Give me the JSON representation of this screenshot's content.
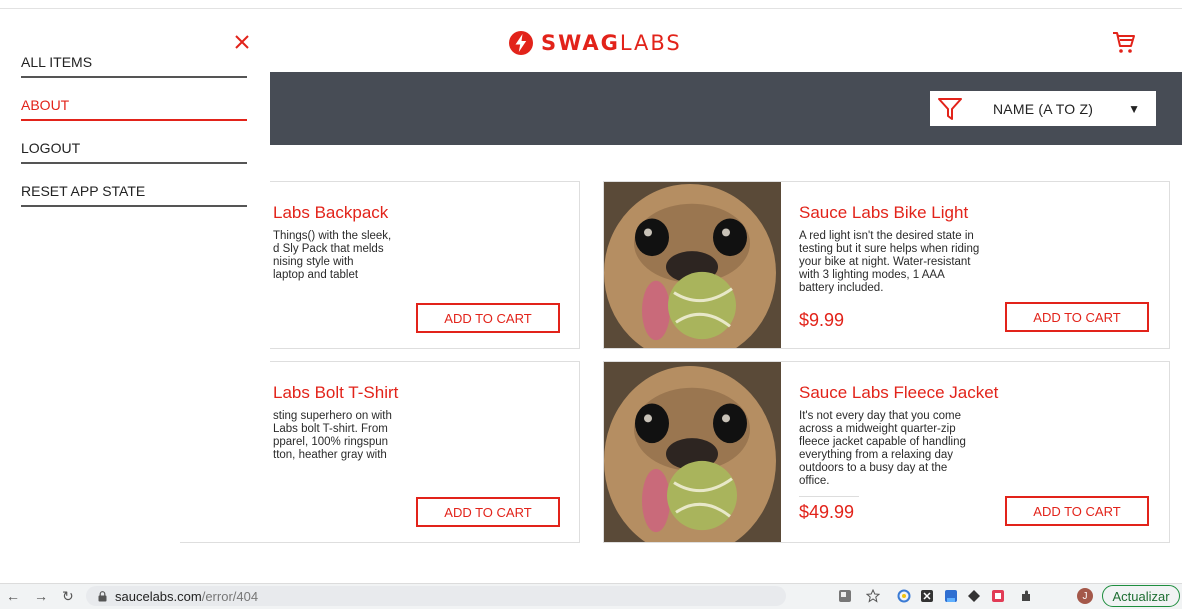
{
  "header": {
    "logo_bold": "SWAG",
    "logo_light": "LABS"
  },
  "sort": {
    "selected": "NAME (A TO Z)"
  },
  "menu": {
    "items": [
      {
        "label": "ALL ITEMS"
      },
      {
        "label": "ABOUT"
      },
      {
        "label": "LOGOUT"
      },
      {
        "label": "RESET APP STATE"
      }
    ]
  },
  "products": [
    {
      "title": "Labs Backpack",
      "desc_lines": [
        "Things() with the sleek,",
        "d Sly Pack that melds",
        "nising style with",
        "laptop and tablet"
      ],
      "button": "ADD TO CART"
    },
    {
      "title": "Sauce Labs Bike Light",
      "desc_lines": [
        "A red light isn't the desired state in",
        "testing but it sure helps when riding",
        "your bike at night. Water-resistant",
        "with 3 lighting modes, 1 AAA",
        "battery included."
      ],
      "price": "$9.99",
      "button": "ADD TO CART"
    },
    {
      "title": "Labs Bolt T-Shirt",
      "desc_lines": [
        "sting superhero on with",
        "Labs bolt T-shirt. From",
        "pparel, 100% ringspun",
        "tton, heather gray with"
      ],
      "button": "ADD TO CART"
    },
    {
      "title": "Sauce Labs Fleece Jacket",
      "desc_lines": [
        "It's not every day that you come",
        "across a midweight quarter-zip",
        "fleece jacket capable of handling",
        "everything from a relaxing day",
        "outdoors to a busy day at the",
        "office."
      ],
      "price": "$49.99",
      "button": "ADD TO CART"
    }
  ],
  "browser": {
    "url_host": "saucelabs.com",
    "url_path": "/error/404",
    "profile_initial": "J",
    "update_label": "Actualizar"
  },
  "colors": {
    "accent": "#e2231a",
    "bar": "#474c55",
    "update_green": "#1e8e3e"
  },
  "icons": [
    "close-icon",
    "cart-icon",
    "filter-icon",
    "dropdown-arrow-icon",
    "lock-icon",
    "back-arrow-icon",
    "forward-arrow-icon",
    "reload-icon",
    "star-icon",
    "translate-icon"
  ]
}
